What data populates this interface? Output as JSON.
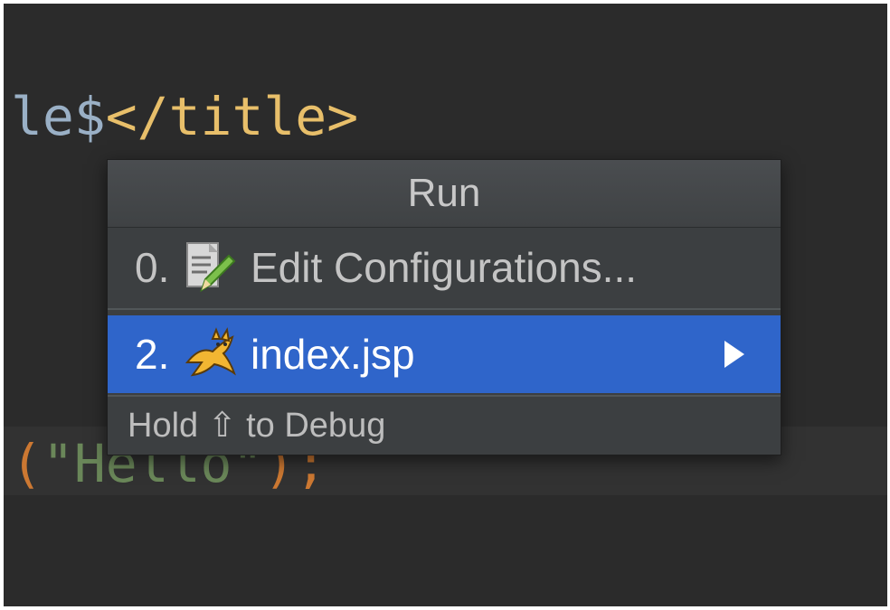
{
  "editor": {
    "line1": {
      "var": "le$",
      "tag": "</title>"
    },
    "line2": {
      "open": "(",
      "string": "\"Hello\"",
      "close": ");"
    }
  },
  "popup": {
    "title": "Run",
    "items": [
      {
        "index": "0.",
        "label": "Edit Configurations...",
        "icon": "edit-config-icon"
      },
      {
        "index": "2.",
        "label": "index.jsp",
        "icon": "tomcat-icon",
        "selected": true,
        "has_submenu": true
      }
    ],
    "footer": "Hold ⇧ to Debug"
  },
  "colors": {
    "editor_bg": "#2b2b2b",
    "popup_bg": "#3c3f41",
    "selection": "#2f65ca",
    "tag": "#e8bf6a",
    "string": "#6a8759",
    "punctuation": "#cc7832"
  }
}
